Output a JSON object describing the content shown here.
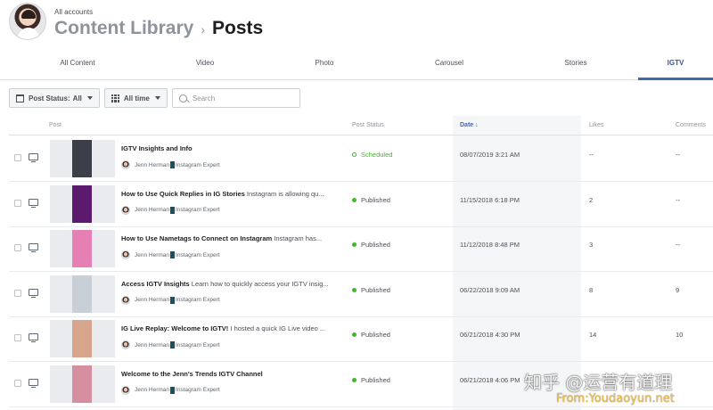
{
  "header": {
    "account_label": "All accounts",
    "breadcrumb_parent": "Content Library",
    "breadcrumb_separator": "›",
    "page_title": "Posts"
  },
  "tabs": [
    {
      "label": "All Content",
      "active": false
    },
    {
      "label": "Video",
      "active": false
    },
    {
      "label": "Photo",
      "active": false
    },
    {
      "label": "Carousel",
      "active": false
    },
    {
      "label": "Stories",
      "active": false
    },
    {
      "label": "IGTV",
      "active": true
    }
  ],
  "filters": {
    "post_status_label": "Post Status:",
    "post_status_value": "All",
    "time_label": "All time",
    "search_placeholder": "Search"
  },
  "table": {
    "columns": {
      "post": "Post",
      "status": "Post Status",
      "date": "Date ↓",
      "likes": "Likes",
      "comments": "Comments"
    },
    "rows": [
      {
        "title": "IGTV Insights and Info",
        "desc": "",
        "author": "Jenn Herman",
        "role": "Instagram Expert",
        "status": "Scheduled",
        "date": "08/07/2019 3:21 AM",
        "likes": "--",
        "comments": "--",
        "thumb_color": "#3a3f4a"
      },
      {
        "title": "How to Use Quick Replies in IG Stories",
        "desc": "Instagram is allowing qu...",
        "author": "Jenn Herman",
        "role": "Instagram Expert",
        "status": "Published",
        "date": "11/15/2018 6:18 PM",
        "likes": "2",
        "comments": "--",
        "thumb_color": "#5b1a6e"
      },
      {
        "title": "How to Use Nametags to Connect on Instagram",
        "desc": "Instagram has...",
        "author": "Jenn Herman",
        "role": "Instagram Expert",
        "status": "Published",
        "date": "11/12/2018 8:48 PM",
        "likes": "3",
        "comments": "--",
        "thumb_color": "#e680b4"
      },
      {
        "title": "Access IGTV Insights",
        "desc": "Learn how to quickly access your IGTV insig...",
        "author": "Jenn Herman",
        "role": "Instagram Expert",
        "status": "Published",
        "date": "06/22/2018 9:09 AM",
        "likes": "8",
        "comments": "9",
        "thumb_color": "#c9cfd6"
      },
      {
        "title": "IG Live Replay: Welcome to IGTV!",
        "desc": "I hosted a quick IG Live video ...",
        "author": "Jenn Herman",
        "role": "Instagram Expert",
        "status": "Published",
        "date": "06/21/2018 4:30 PM",
        "likes": "14",
        "comments": "10",
        "thumb_color": "#d6a58c"
      },
      {
        "title": "Welcome to the Jenn's Trends IGTV Channel",
        "desc": "",
        "author": "Jenn Herman",
        "role": "Instagram Expert",
        "status": "Published",
        "date": "06/21/2018 4:06 PM",
        "likes": "",
        "comments": "",
        "thumb_color": "#d68fa0"
      }
    ]
  },
  "watermark": {
    "line1": "知乎 @运营有道理",
    "line2": "From:Youdaoyun.net"
  },
  "colors": {
    "accent": "#4267b2",
    "published_dot": "#42b72a"
  }
}
